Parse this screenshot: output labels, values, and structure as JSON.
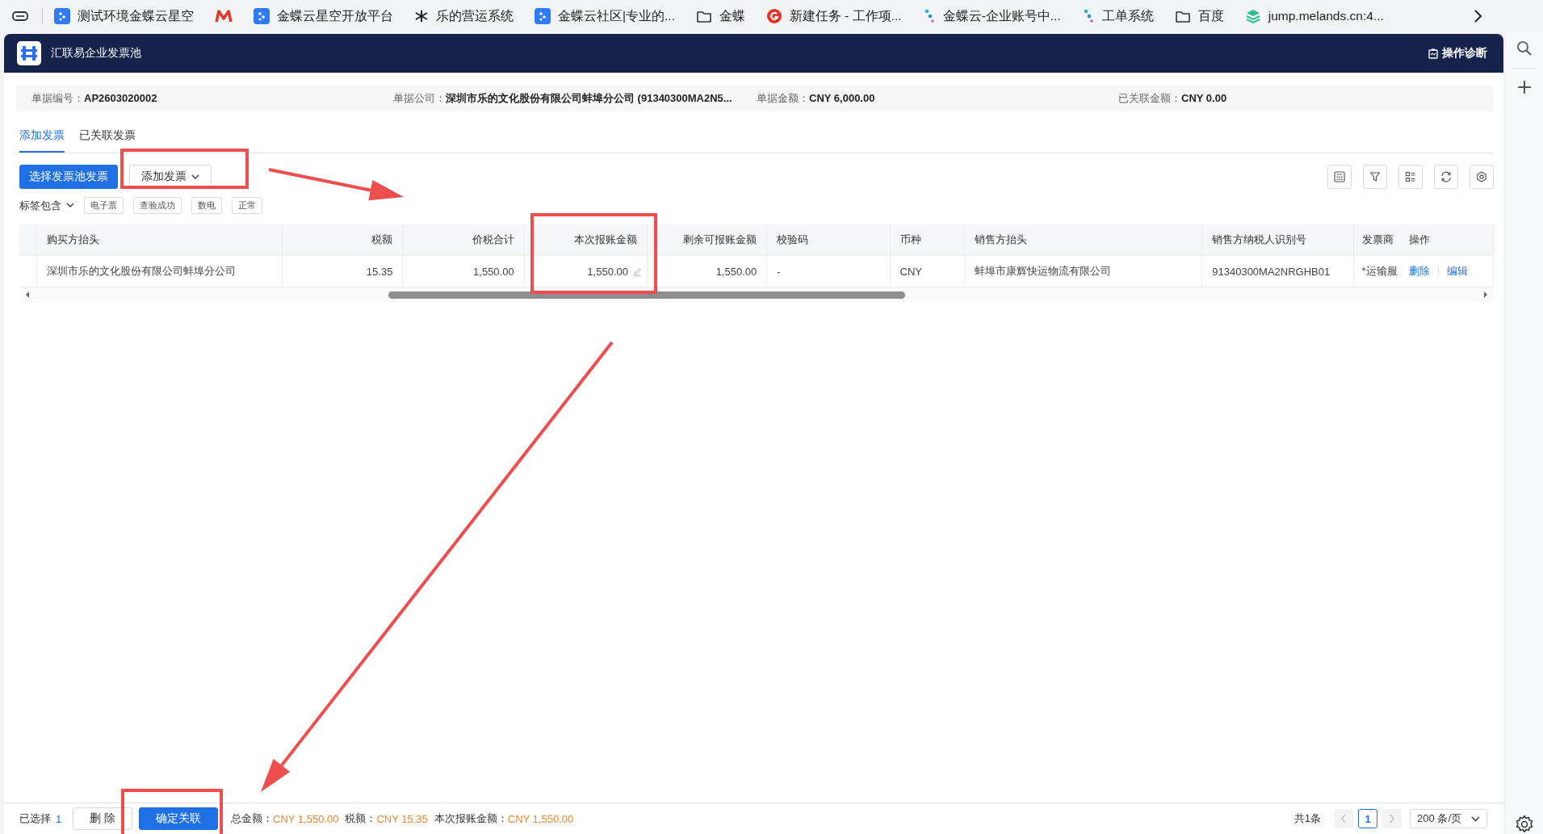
{
  "browser": {
    "bookmarks": [
      {
        "label": "测试环境金蝶云星空",
        "kind": "app"
      },
      {
        "kind": "zigzag"
      },
      {
        "label": "金蝶云星空开放平台",
        "kind": "app"
      },
      {
        "label": "乐的营运系统",
        "kind": "asterisk"
      },
      {
        "label": "金蝶云社区|专业的...",
        "kind": "app"
      },
      {
        "label": "金蝶",
        "kind": "folder"
      },
      {
        "label": "新建任务 - 工作项...",
        "kind": "circle"
      },
      {
        "label": "金蝶云-企业账号中...",
        "kind": "dots"
      },
      {
        "label": "工单系统",
        "kind": "dots"
      },
      {
        "label": "百度",
        "kind": "folder"
      },
      {
        "label": "jump.melands.cn:4...",
        "kind": "layers"
      }
    ]
  },
  "header": {
    "title": "汇联易企业发票池",
    "action": "操作诊断"
  },
  "info": [
    {
      "label": "单据编号：",
      "value": "AP2603020002"
    },
    {
      "label": "单据公司：",
      "value": "深圳市乐的文化股份有限公司蚌埠分公司 (91340300MA2N5..."
    },
    {
      "label": "单据金额：",
      "value": "CNY 6,000.00"
    },
    {
      "label": "已关联金额：",
      "value": "CNY 0.00"
    }
  ],
  "tabs": [
    {
      "label": "添加发票",
      "selected": true
    },
    {
      "label": "已关联发票",
      "selected": false
    }
  ],
  "toolbar": {
    "primary": "选择发票池发票",
    "dropdown": "添加发票"
  },
  "tag_filter": {
    "label": "标签包含",
    "tags": [
      "电子票",
      "查验成功",
      "数电",
      "正常"
    ]
  },
  "table": {
    "columns": [
      {
        "label": "购买方抬头",
        "kind": "text",
        "editable": false
      },
      {
        "label": "税额",
        "kind": "amount",
        "editable": false
      },
      {
        "label": "价税合计",
        "kind": "amount",
        "editable": false
      },
      {
        "label": "本次报账金额",
        "kind": "amount",
        "editable": true
      },
      {
        "label": "剩余可报账金额",
        "kind": "amount",
        "editable": false
      },
      {
        "label": "校验码",
        "kind": "text",
        "editable": false
      },
      {
        "label": "币种",
        "kind": "text",
        "editable": false
      },
      {
        "label": "销售方抬头",
        "kind": "text",
        "editable": false
      },
      {
        "label": "销售方纳税人识别号",
        "kind": "text",
        "editable": false
      },
      {
        "label": "发票商",
        "kind": "text",
        "editable": false
      }
    ],
    "action_column": "操作",
    "rows": [
      {
        "cells": [
          "深圳市乐的文化股份有限公司蚌埠分公司",
          "15.35",
          "1,550.00",
          "1,550.00",
          "1,550.00",
          "-",
          "CNY",
          "蚌埠市康辉快运物流有限公司",
          "91340300MA2NRGHB01",
          "*运输服"
        ],
        "actions": [
          "删除",
          "编辑"
        ]
      }
    ]
  },
  "footer": {
    "selected_label": "已选择",
    "selected_count": "1",
    "buttons": [
      {
        "label": "删 除",
        "kind": "default"
      },
      {
        "label": "确定关联",
        "kind": "primary"
      }
    ],
    "summary": [
      {
        "label": "总金额：",
        "value": "CNY 1,550.00"
      },
      {
        "label": "税额：",
        "value": "CNY 15.35"
      },
      {
        "label": "本次报账金额：",
        "value": "CNY 1,550.00"
      }
    ],
    "total": "共1条",
    "pages": [
      {
        "label": "1",
        "selected": true
      }
    ],
    "page_size": "200 条/页"
  }
}
